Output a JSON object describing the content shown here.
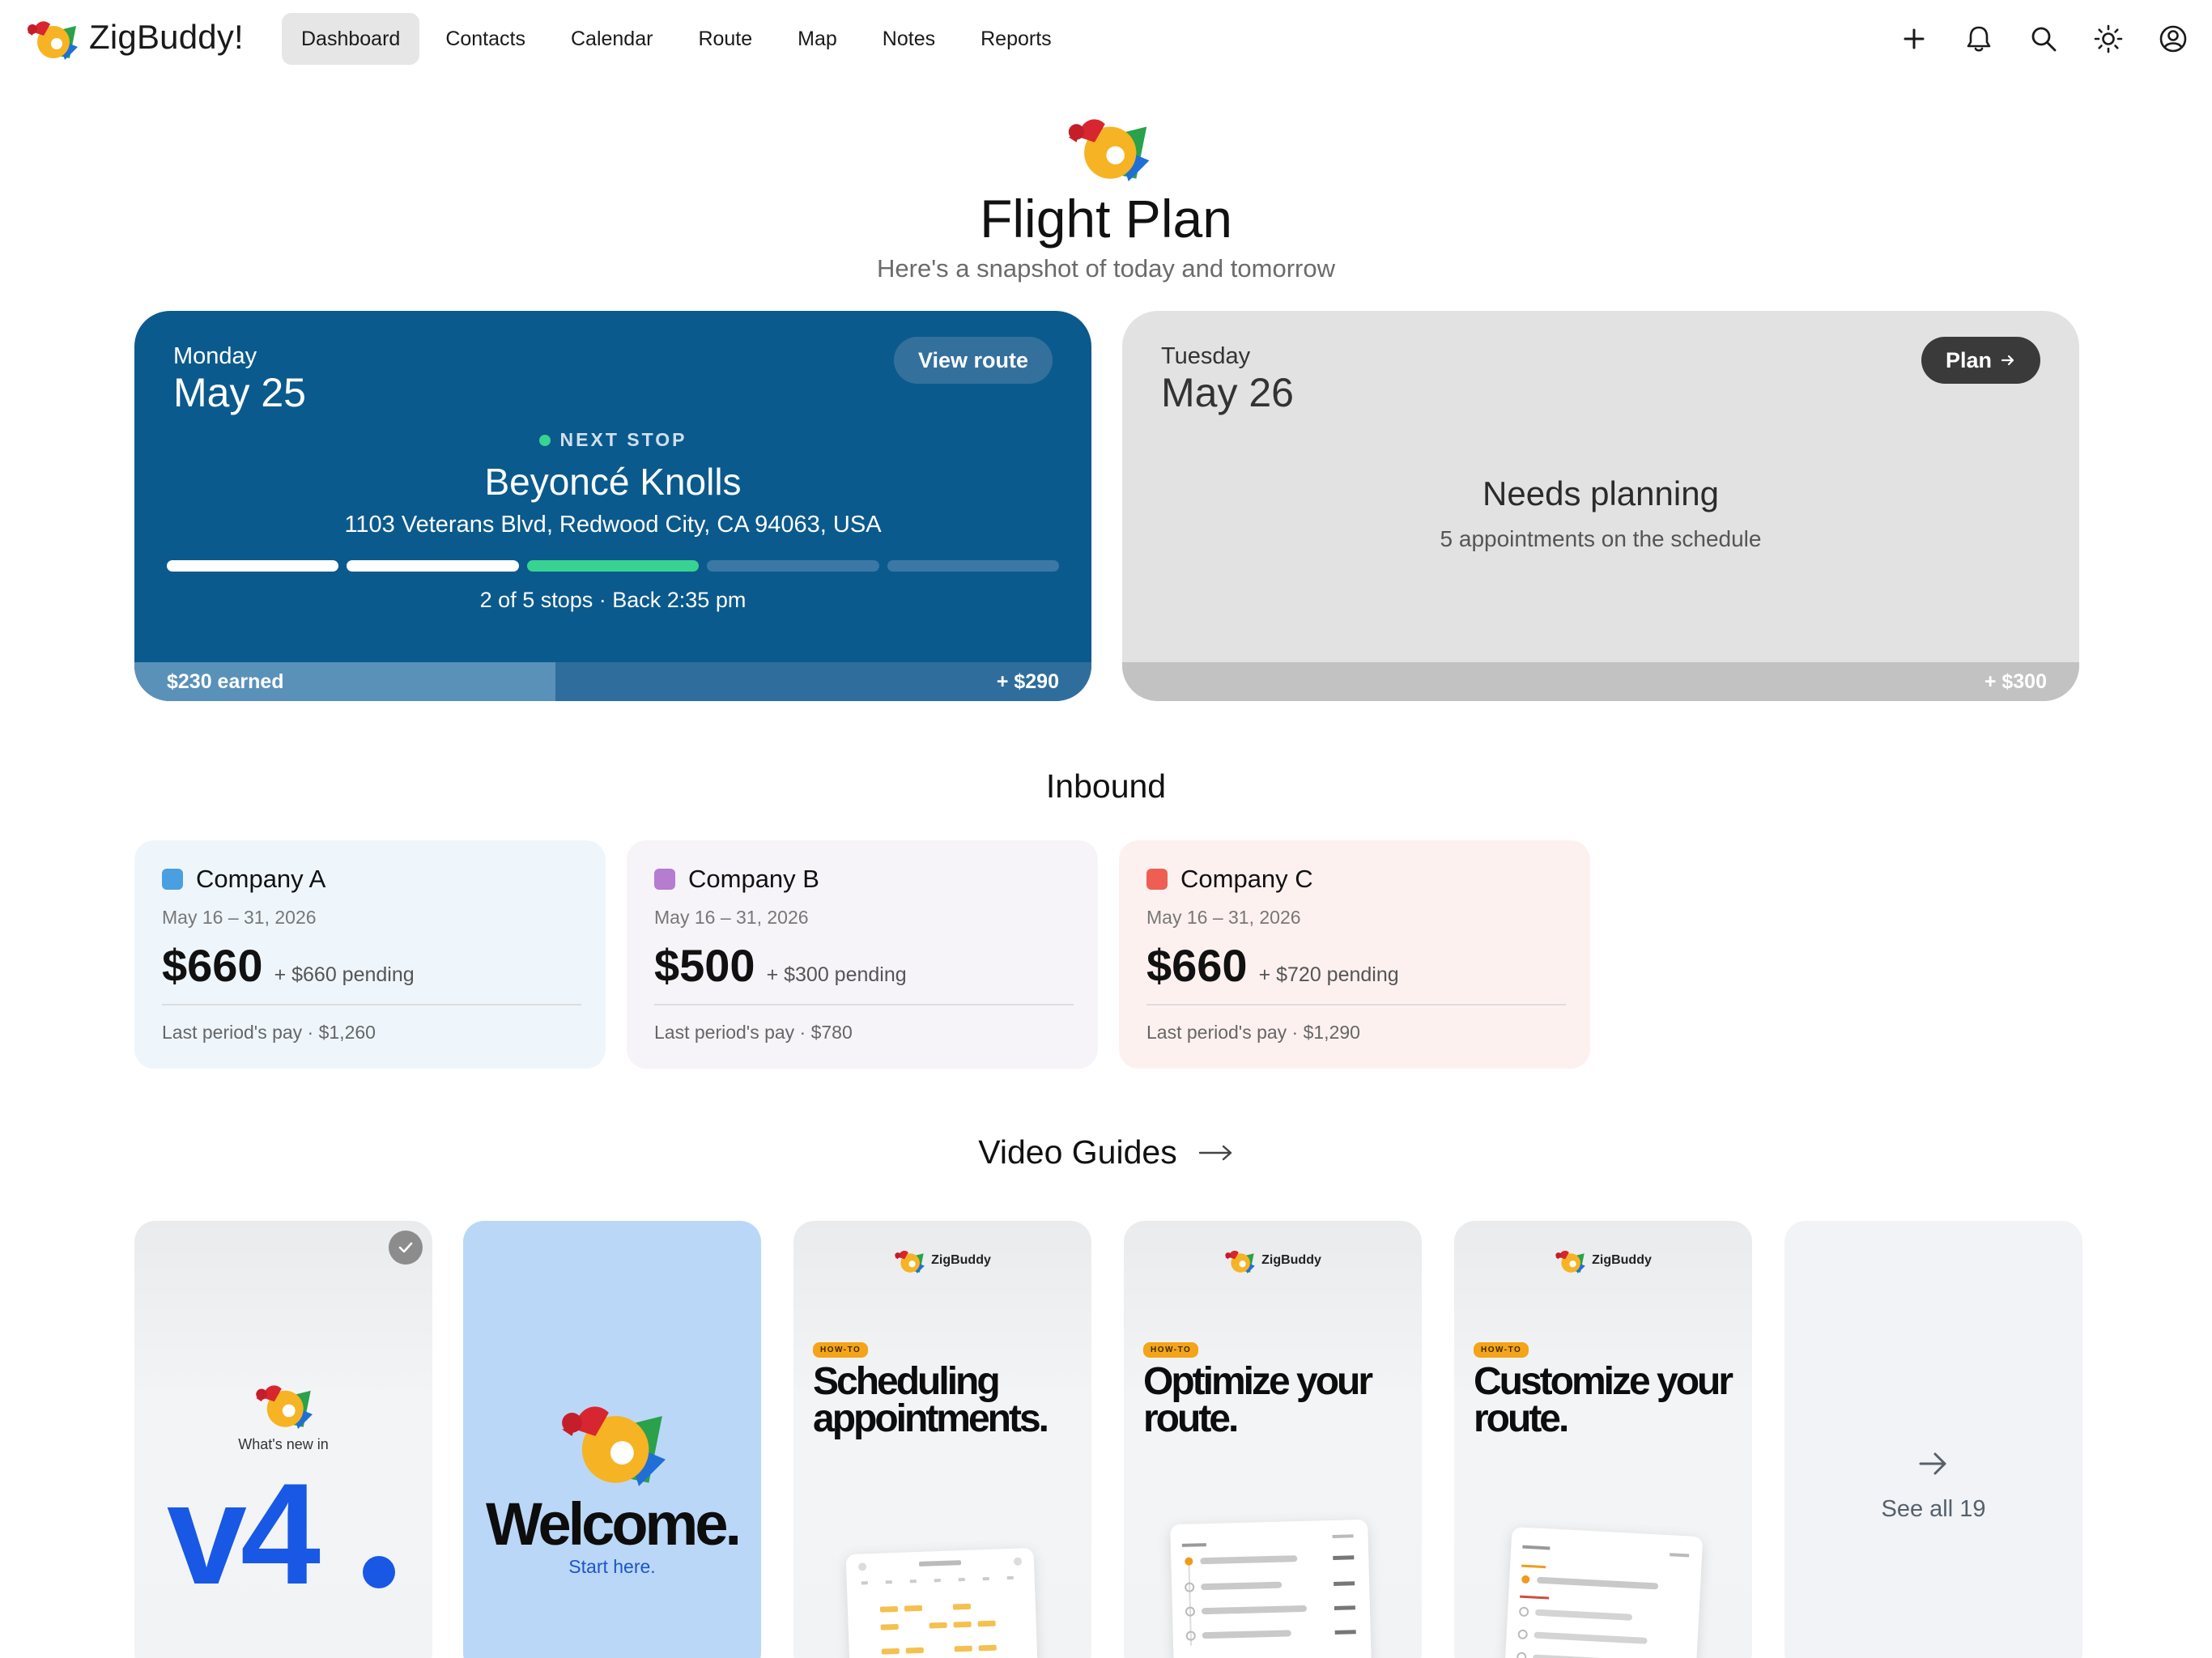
{
  "app": {
    "name": "ZigBuddy!"
  },
  "nav": {
    "items": [
      {
        "label": "Dashboard",
        "active": true
      },
      {
        "label": "Contacts"
      },
      {
        "label": "Calendar"
      },
      {
        "label": "Route"
      },
      {
        "label": "Map"
      },
      {
        "label": "Notes"
      },
      {
        "label": "Reports"
      }
    ],
    "actions": [
      "plus-icon",
      "bell-icon",
      "search-icon",
      "sun-icon",
      "account-icon"
    ]
  },
  "hero": {
    "title": "Flight Plan",
    "subtitle": "Here's a snapshot of today and tomorrow"
  },
  "today": {
    "weekday": "Monday",
    "date": "May 25",
    "action_label": "View route",
    "next_stop_label": "NEXT STOP",
    "stop_name": "Beyoncé Knolls",
    "stop_address": "1103 Veterans Blvd, Redwood City, CA 94063, USA",
    "stops_done": 2,
    "stops_total": 5,
    "summary": "2 of 5 stops · Back 2:35 pm",
    "earned_label": "$230 earned",
    "pending_label": "+ $290",
    "earned_fraction": 0.44
  },
  "tomorrow": {
    "weekday": "Tuesday",
    "date": "May 26",
    "action_label": "Plan",
    "status_title": "Needs planning",
    "status_sub": "5 appointments on the schedule",
    "pending_label": "+ $300"
  },
  "inbound": {
    "title": "Inbound",
    "companies": [
      {
        "name": "Company A",
        "period": "May 16 – 31, 2026",
        "amount": "$660",
        "pending": "+ $660 pending",
        "last": "Last period's pay · $1,260",
        "color": "#4a9fe0",
        "bg": "#eef6fc"
      },
      {
        "name": "Company B",
        "period": "May 16 – 31, 2026",
        "amount": "$500",
        "pending": "+ $300 pending",
        "last": "Last period's pay · $780",
        "color": "#b57ccf",
        "bg": "#f6f4f9"
      },
      {
        "name": "Company C",
        "period": "May 16 – 31, 2026",
        "amount": "$660",
        "pending": "+ $720 pending",
        "last": "Last period's pay · $1,290",
        "color": "#ee5e52",
        "bg": "#fdf1f0"
      }
    ]
  },
  "guides": {
    "title": "Video Guides",
    "items": [
      {
        "kicker": "What's new in",
        "headline": "v4"
      },
      {
        "headline": "Welcome.",
        "sub": "Start here."
      },
      {
        "brand": "ZigBuddy",
        "tag": "HOW-TO",
        "headline": "Scheduling appointments."
      },
      {
        "brand": "ZigBuddy",
        "tag": "HOW-TO",
        "headline": "Optimize your route."
      },
      {
        "brand": "ZigBuddy",
        "tag": "HOW-TO",
        "headline": "Customize your route."
      }
    ],
    "see_all": "See all 19"
  },
  "colors": {
    "accent_blue": "#0b5a8d",
    "progress_green": "#38d391",
    "v4_blue": "#1858e5"
  }
}
